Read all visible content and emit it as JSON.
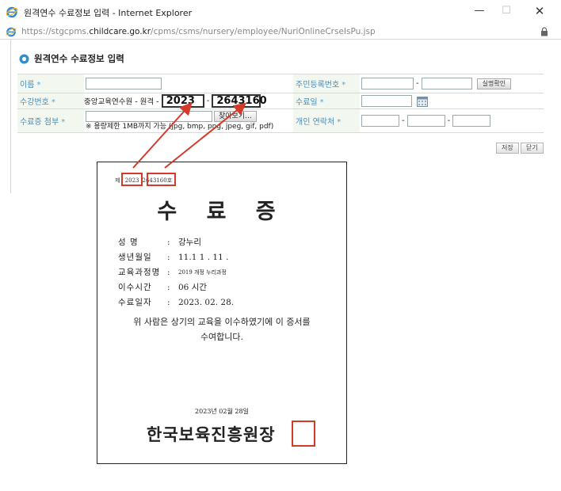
{
  "window": {
    "title": "원격연수 수료정보 입력 - Internet Explorer",
    "min_glyph": "—",
    "max_glyph": "☐",
    "close_glyph": "✕"
  },
  "address": {
    "prefix": "https://stgcpms.",
    "host": "childcare.go.kr",
    "path": "/cpms/csms/nursery/employee/NuriOnlineCrseIsPu.jsp"
  },
  "section": {
    "title": "원격연수 수료정보 입력"
  },
  "form": {
    "required_mark": "*",
    "name_label": "이름",
    "name_value": "",
    "rrn_label": "주민등록번호",
    "rrn_front": "",
    "rrn_back": "",
    "verify_btn": "실명확인",
    "course_no_label": "수강번호",
    "course_prefix": "중앙교육연수원 - 원격 -",
    "course_year": "2023",
    "course_number": "2643160",
    "complete_date_label": "수료일",
    "complete_date_value": "",
    "attach_label": "수료증 첨부",
    "file_value": "",
    "file_btn": "찾아보기...",
    "file_note": "※ 용량제한 1MB까지 가능 (jpg, bmp, png, jpeg, gif, pdf)",
    "phone_label": "개인 연락처",
    "phone1": "",
    "phone2": "",
    "phone3": "",
    "save_btn": "저장",
    "close_btn": "닫기"
  },
  "certificate": {
    "no_prefix": "제",
    "no_year": "2023",
    "no_number": "2643160",
    "no_suffix": "호",
    "title": "수 료 증",
    "fields": [
      {
        "key": "성      명",
        "value": "강누리"
      },
      {
        "key": "생년월일",
        "value": "11.1 1 . 11 ."
      },
      {
        "key": "교육과정명",
        "value": "2019 개정 누리과정"
      },
      {
        "key": "이수시간",
        "value": "06 시간"
      },
      {
        "key": "수료일자",
        "value": "2023. 02. 28."
      }
    ],
    "sep": ":",
    "body_line1": "위 사람은 상기의 교육을 이수하였기에 이 증서를",
    "body_line2": "수여합니다.",
    "issue_date": "2023년 02월 28일",
    "issuer": "한국보육진흥원",
    "seal_char": "장"
  },
  "colors": {
    "label_text": "#4d8bb6",
    "label_bg": "#f2f7ef",
    "highlight_red": "#d23a2a"
  }
}
